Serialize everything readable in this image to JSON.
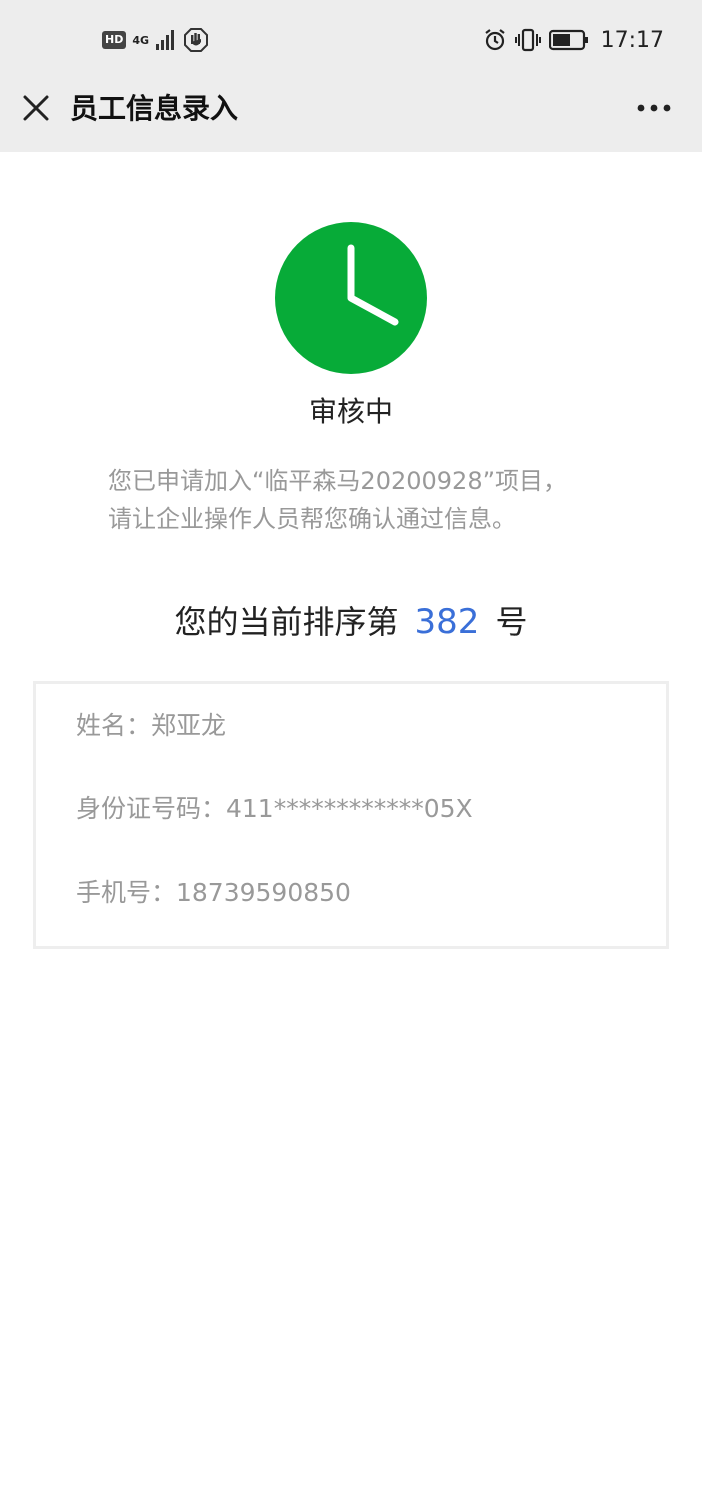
{
  "status_bar": {
    "hd": "HD",
    "network": "4G",
    "time": "17:17"
  },
  "nav": {
    "title": "员工信息录入",
    "close_icon": "close-icon",
    "more_icon": "more-icon"
  },
  "status": {
    "icon": "clock-icon",
    "icon_color": "#07ab38",
    "title": "审核中"
  },
  "message": {
    "line1": "您已申请加入“临平森马20200928”项目，",
    "line2": "请让企业操作人员帮您确认通过信息。"
  },
  "queue": {
    "prefix": "您的当前排序第",
    "number": "382",
    "suffix": "号",
    "number_color": "#3a6fd8"
  },
  "info": {
    "name": "姓名：郑亚龙",
    "id_number": "身份证号码：411************05X",
    "phone": "手机号：18739590850"
  }
}
